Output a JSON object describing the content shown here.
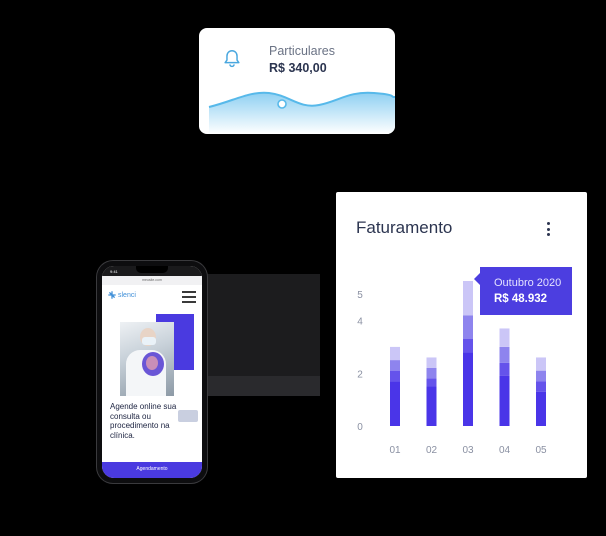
{
  "particulares_card": {
    "label": "Particulares",
    "amount": "R$ 340,00",
    "icon": "bell-icon",
    "wave_color": "#57b9ea"
  },
  "phone": {
    "status_time": "9:41",
    "url": "meusite.com",
    "logo_text": "slenci",
    "headline": "Agende online sua consulta ou procedimento na clínica.",
    "cta_label": "Agendamento",
    "accent": "#4a3ae0"
  },
  "faturamento_card": {
    "title": "Faturamento",
    "menu_icon": "kebab-menu-icon",
    "tooltip": {
      "label": "Outubro 2020",
      "value": "R$ 48.932"
    },
    "colors": {
      "dark": "#4a35e8",
      "mid": "#8e84ee",
      "light": "#cbc6f7"
    }
  },
  "chart_data": {
    "type": "bar",
    "categories": [
      "01",
      "02",
      "03",
      "04",
      "05"
    ],
    "series": [
      {
        "values": [
          1.7,
          1.5,
          2.8,
          1.9,
          1.3
        ]
      },
      {
        "values": [
          0.4,
          0.3,
          0.5,
          0.5,
          0.4
        ]
      },
      {
        "values": [
          0.4,
          0.4,
          0.9,
          0.6,
          0.4
        ]
      },
      {
        "values": [
          0.5,
          0.4,
          1.3,
          0.7,
          0.5
        ]
      }
    ],
    "y_ticks": [
      "0",
      "2",
      "4",
      "5"
    ],
    "ylim": [
      0,
      5.5
    ]
  }
}
